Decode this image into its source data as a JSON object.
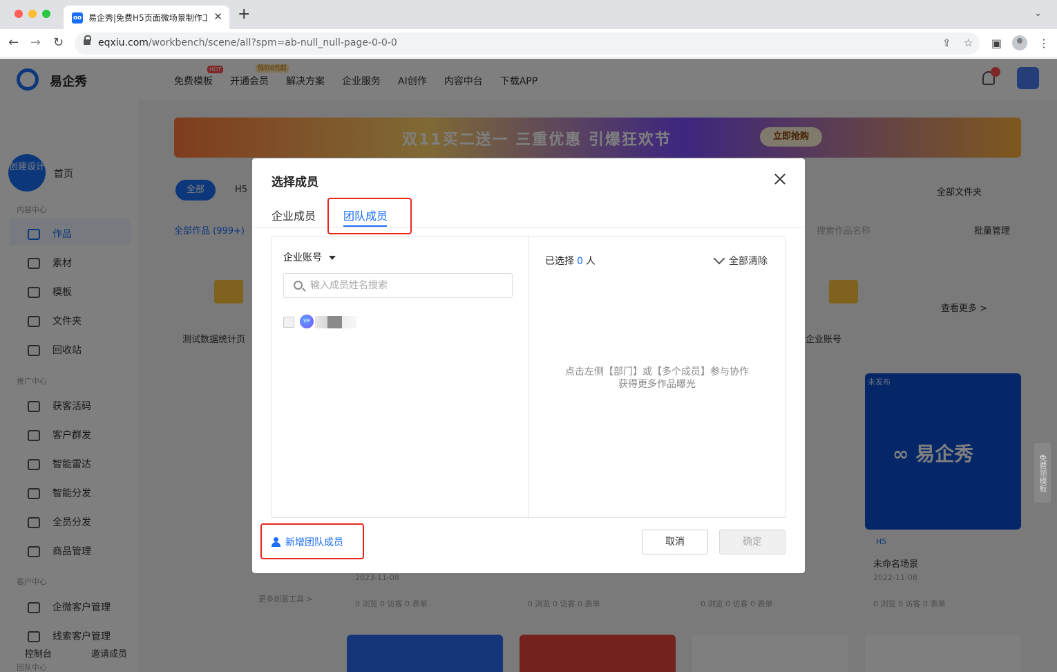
{
  "browser": {
    "tab_title": "易企秀|免费H5页面微场景制作工",
    "tab_favicon": "oo",
    "url_host": "eqxiu.com",
    "url_path": "/workbench/scene/all?spm=ab-null_null-page-0-0-0"
  },
  "app": {
    "logo_text": "易企秀",
    "nav": [
      "免费模板",
      "开通会员",
      "解决方案",
      "企业服务",
      "AI创作",
      "内容中台",
      "下载APP"
    ],
    "hot_badge": "HOT",
    "vip_badge": "低价0元起",
    "create_label": "创建设计",
    "home": "首页",
    "section_content": "内容中心",
    "content_items": [
      "作品",
      "素材",
      "模板",
      "文件夹",
      "回收站"
    ],
    "section_promo": "推广中心",
    "promo_items": [
      "获客活码",
      "客户群发",
      "智能雷达",
      "智能分发",
      "全员分发",
      "商品管理"
    ],
    "section_customer": "客户中心",
    "customer_items": [
      "企微客户管理",
      "线索客户管理"
    ],
    "section_team": "团队中心",
    "bottom_console": "控制台",
    "bottom_invite": "邀请成员",
    "banner_text": "双11买二送一  三重优惠 引爆狂欢节",
    "banner_button": "立即抢购",
    "filter_all": "全部",
    "filter_h5": "H5",
    "all_works": "全部作品 (999+)",
    "folder_all": "全部文件夹",
    "batch_manage": "批量管理",
    "search_works_placeholder": "搜索作品名称",
    "see_more": "查看更多 >",
    "folder_test": "测试数据统计页",
    "enterprise_account_hint": "企业账号",
    "card_status": "未发布",
    "card_logo": "∞ 易企秀",
    "card_type": "H5",
    "card_title": "未命名场景",
    "card_date": "2022-11-08",
    "card_date_2": "2023-11-08",
    "card_stats": "0 浏览  0 访客  0 表单",
    "more_tools": "更多创意工具 >",
    "float_tab": "免费领模板"
  },
  "modal": {
    "title": "选择成员",
    "tabs": [
      "企业成员",
      "团队成员"
    ],
    "active_tab": 1,
    "account_select": "企业账号",
    "search_placeholder": "输入成员姓名搜索",
    "member_avatar_text": "VIP",
    "selected_prefix": "已选择",
    "selected_count": "0",
    "selected_suffix": "人",
    "clear_all": "全部清除",
    "empty_hint_line1": "点击左侧【部门】或【多个成员】参与协作",
    "empty_hint_line2": "获得更多作品曝光",
    "add_team_member": "新增团队成员",
    "cancel": "取消",
    "confirm": "确定"
  },
  "colors": {
    "accent": "#1a6ef6",
    "highlight_box": "#e8251d"
  }
}
